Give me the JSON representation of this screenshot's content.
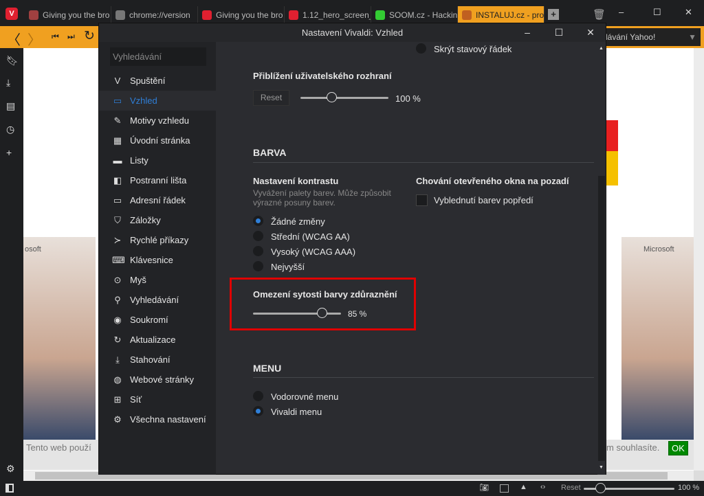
{
  "tabs": [
    {
      "title": "Giving you the bro",
      "color": "#a04040"
    },
    {
      "title": "chrome://version",
      "color": "#777"
    },
    {
      "title": "Giving you the bro",
      "color": "#e02030"
    },
    {
      "title": "1.12_hero_screen_",
      "color": "#e02030"
    },
    {
      "title": "SOOM.cz - Hackin",
      "color": "#3c3"
    },
    {
      "title": "INSTALUJ.cz - pro",
      "color": "#c06020"
    }
  ],
  "address": {
    "search_placeholder": "dávání Yahoo!"
  },
  "page": {
    "cookie_left": "Tento web použí",
    "cookie_right": "m souhlasíte.",
    "ok": "OK",
    "ms_left": "osoft",
    "ms_right": "Microsoft"
  },
  "status": {
    "reset": "Reset",
    "zoom": "100 %",
    "zoom_value": 100
  },
  "dialog": {
    "title": "Nastavení Vivaldi: Vzhled",
    "search_placeholder": "Vyhledávání",
    "sidebar": [
      {
        "label": "Spuštění",
        "icon": "vivaldi-icon",
        "glyph": "V"
      },
      {
        "label": "Vzhled",
        "icon": "window-icon",
        "glyph": "▭",
        "active": true
      },
      {
        "label": "Motivy vzhledu",
        "icon": "brush-icon",
        "glyph": "✎"
      },
      {
        "label": "Úvodní stránka",
        "icon": "grid-icon",
        "glyph": "▦"
      },
      {
        "label": "Listy",
        "icon": "tabs-icon",
        "glyph": "▬"
      },
      {
        "label": "Postranní lišta",
        "icon": "sidebar-icon",
        "glyph": "◧"
      },
      {
        "label": "Adresní řádek",
        "icon": "address-bar-icon",
        "glyph": "▭"
      },
      {
        "label": "Záložky",
        "icon": "bookmark-icon",
        "glyph": "⛉"
      },
      {
        "label": "Rychlé příkazy",
        "icon": "command-icon",
        "glyph": "≻"
      },
      {
        "label": "Klávesnice",
        "icon": "keyboard-icon",
        "glyph": "⌨"
      },
      {
        "label": "Myš",
        "icon": "mouse-icon",
        "glyph": "⊙"
      },
      {
        "label": "Vyhledávání",
        "icon": "search-icon",
        "glyph": "⚲"
      },
      {
        "label": "Soukromí",
        "icon": "eye-icon",
        "glyph": "◉"
      },
      {
        "label": "Aktualizace",
        "icon": "update-icon",
        "glyph": "↻"
      },
      {
        "label": "Stahování",
        "icon": "download-icon",
        "glyph": "⤓"
      },
      {
        "label": "Webové stránky",
        "icon": "globe-icon",
        "glyph": "◍"
      },
      {
        "label": "Síť",
        "icon": "network-icon",
        "glyph": "⊞"
      },
      {
        "label": "Všechna nastavení",
        "icon": "gear-icon",
        "glyph": "⚙"
      }
    ],
    "hide_status": "Skrýt stavový řádek",
    "ui_zoom": {
      "title": "Přiblížení uživatelského rozhraní",
      "reset": "Reset",
      "value_label": "100 %",
      "value": 100
    },
    "color": {
      "heading": "BARVA",
      "contrast_title": "Nastavení kontrastu",
      "contrast_desc1": "Vyvážení palety barev. Může způsobit",
      "contrast_desc2": "výrazné posuny barev.",
      "options": [
        "Žádné změny",
        "Střední (WCAG AA)",
        "Vysoký (WCAG AAA)",
        "Nejvyšší"
      ],
      "selected": 0,
      "bg_title": "Chování otevřeného okna na pozadí",
      "bg_checkbox": "Vyblednutí barev popředí",
      "sat_title": "Omezení sytosti barvy zdůraznění",
      "sat_label": "85 %",
      "sat_value": 85,
      "highlight_color": "#e00000"
    },
    "menu": {
      "heading": "MENU",
      "options": [
        "Vodorovné menu",
        "Vivaldi menu"
      ],
      "selected": 1
    }
  }
}
